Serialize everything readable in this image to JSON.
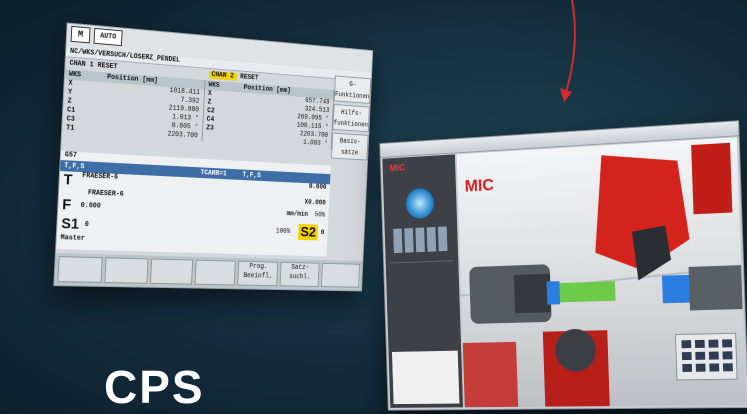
{
  "hmi": {
    "mode": "AUTO",
    "path": "NC/WKS/VERSUCH/LOSERZ_PENDEL",
    "chan1": "CHAN 1",
    "chan1_status": "RESET",
    "chan2": "CHAN 2",
    "chan2_status": "RESET",
    "col_wks": "WKS",
    "col_pos": "Position [mm]",
    "axes_left": [
      {
        "name": "X",
        "value": "1018.411"
      },
      {
        "name": "Y",
        "value": "7.392"
      },
      {
        "name": "Z",
        "value": "2119.880"
      },
      {
        "name": "C1",
        "value": "1.013 °"
      },
      {
        "name": "C3",
        "value": "0.005 °"
      },
      {
        "name": "T1",
        "value": "2203.700"
      }
    ],
    "axes_right": [
      {
        "name": "X",
        "value": "657.749"
      },
      {
        "name": "Z",
        "value": "324.513"
      },
      {
        "name": "C2",
        "value": "269.095 °"
      },
      {
        "name": "C4",
        "value": "100.115 °"
      },
      {
        "name": "Z3",
        "value": "2203.700"
      },
      {
        "name": "",
        "value": "1.003 °"
      }
    ],
    "gcode": "G57",
    "tfs_left": "T,F,S",
    "tfs_right": "T,F,S",
    "tool_label": "T",
    "tool1": "FRAESER-6",
    "tool2": "FRAESER-6",
    "tool_ref": "TCARR=1",
    "tool_vals": [
      "0.000",
      "20.000",
      "X0.000"
    ],
    "feed_label": "F",
    "feed_vals": [
      "0.000",
      "0.000"
    ],
    "feed_unit": "mm/min",
    "feed_pct": "50%",
    "s1": "S1",
    "s1_sub": "Master",
    "s1_val": "0",
    "s1_pct": "100%",
    "s2": "S2",
    "s2_val": "0",
    "softkeys": [
      "G-Funktionen",
      "Hilfs-funktionen",
      "Basis-sätze"
    ],
    "bottom_keys": [
      "Prog. Beeinfl.",
      "Satz-suchl."
    ]
  },
  "sim": {
    "logo": "MIC"
  },
  "headline": "CPS"
}
